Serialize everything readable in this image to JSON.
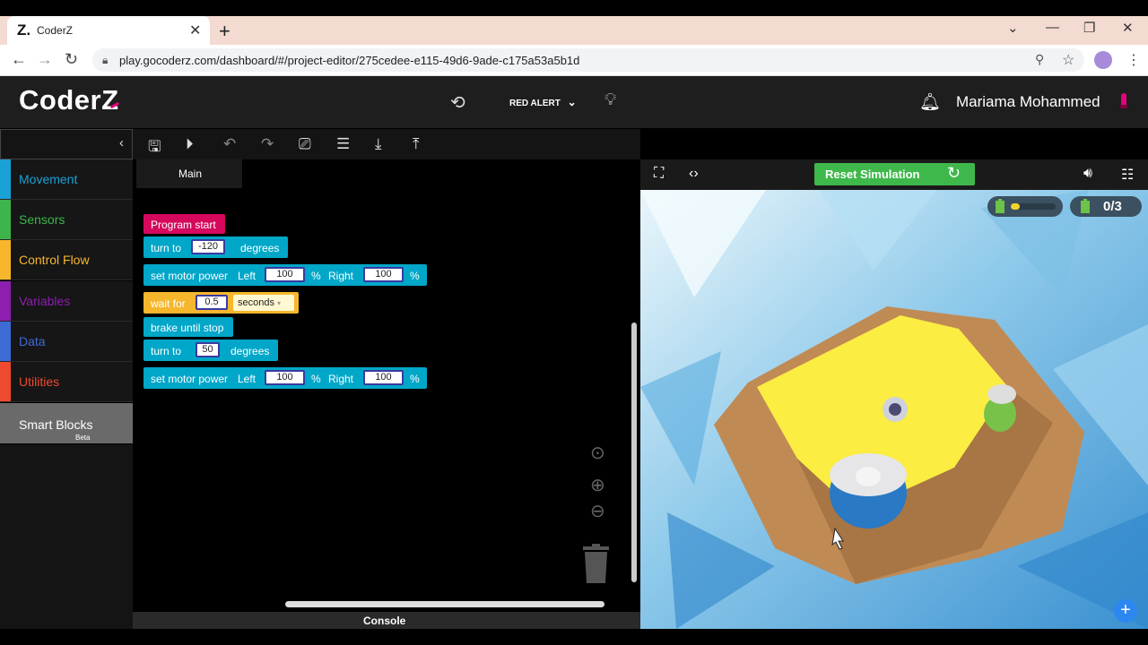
{
  "browser": {
    "tab_favicon": "Z.",
    "tab_title": "CoderZ",
    "new_tab": "+",
    "url": "play.gocoderz.com/dashboard/#/project-editor/275cedee-e115-49d6-9ade-c175a53a5b1d",
    "controls": {
      "dropdown": "⌄",
      "minimize": "—",
      "restore": "❐",
      "close": "✕"
    }
  },
  "app": {
    "logo": "CoderZ",
    "mission": "RED ALERT",
    "user": "Mariama Mohammed"
  },
  "categories": [
    {
      "label": "Movement",
      "color": "#1aa1d6"
    },
    {
      "label": "Sensors",
      "color": "#3db54a"
    },
    {
      "label": "Control Flow",
      "color": "#f6b72d"
    },
    {
      "label": "Variables",
      "color": "#8e1eaf"
    },
    {
      "label": "Data",
      "color": "#3d6bd6"
    },
    {
      "label": "Utilities",
      "color": "#ee4a2f"
    }
  ],
  "smart_blocks": {
    "label": "Smart Blocks",
    "badge": "Beta"
  },
  "workspace": {
    "tab": "Main",
    "console": "Console",
    "blocks": {
      "start": "Program start",
      "turn1": {
        "label": "turn to",
        "value": "-120",
        "unit": "degrees"
      },
      "motor1": {
        "label": "set motor power",
        "left": "Left",
        "left_val": "100",
        "pct1": "%",
        "right": "Right",
        "right_val": "100",
        "pct2": "%"
      },
      "wait": {
        "label": "wait for",
        "value": "0.5",
        "unit": "seconds"
      },
      "brake": "brake until stop",
      "turn2": {
        "label": "turn to",
        "value": "50",
        "unit": "degrees"
      },
      "motor2": {
        "label": "set motor power",
        "left": "Left",
        "left_val": "100",
        "pct1": "%",
        "right": "Right",
        "right_val": "100",
        "pct2": "%"
      }
    }
  },
  "simulation": {
    "reset_label": "Reset Simulation",
    "collected": "0/3",
    "battery_level": 0.2
  }
}
